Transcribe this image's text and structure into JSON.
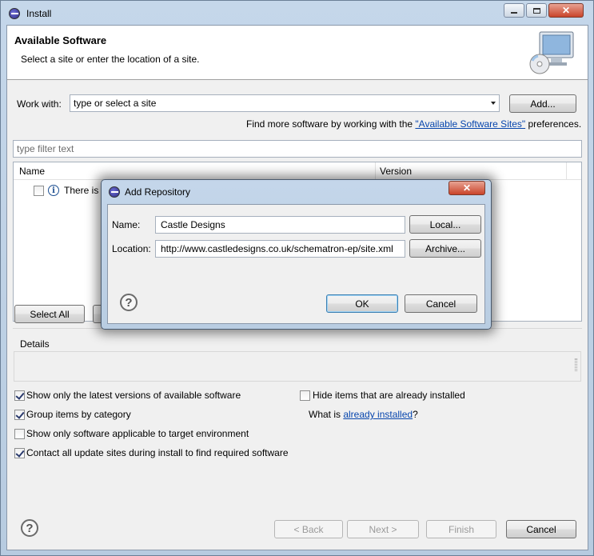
{
  "window": {
    "title": "Install",
    "banner_title": "Available Software",
    "banner_desc": "Select a site or enter the location of a site."
  },
  "work_with": {
    "label": "Work with:",
    "value": "type or select a site",
    "add_button": "Add...",
    "find_more_prefix": "Find more software by working with the ",
    "find_more_link": "\"Available Software Sites\"",
    "find_more_suffix": " preferences."
  },
  "filter": {
    "placeholder": "type filter text"
  },
  "tree": {
    "columns": [
      "Name",
      "Version"
    ],
    "row_text": "There is n"
  },
  "buttons": {
    "select_all": "Select All"
  },
  "details": {
    "label": "Details"
  },
  "options": [
    {
      "label": "Show only the latest versions of available software",
      "checked": true
    },
    {
      "label": "Group items by category",
      "checked": true
    },
    {
      "label": "Show only software applicable to target environment",
      "checked": false
    },
    {
      "label": "Contact all update sites during install to find required software",
      "checked": true
    },
    {
      "label": "Hide items that are already installed",
      "checked": false
    }
  ],
  "what_is": {
    "prefix": "What is ",
    "link": "already installed",
    "suffix": "?"
  },
  "footer": {
    "back": "< Back",
    "next": "Next >",
    "finish": "Finish",
    "cancel": "Cancel"
  },
  "dialog": {
    "title": "Add Repository",
    "name_label": "Name:",
    "name_value": "Castle Designs",
    "location_label": "Location:",
    "location_value": "http://www.castledesigns.co.uk/schematron-ep/site.xml",
    "local_button": "Local...",
    "archive_button": "Archive...",
    "ok_button": "OK",
    "cancel_button": "Cancel"
  },
  "icons": {
    "app": "eclipse-icon",
    "banner": "computer-cd-icon",
    "help": "help-icon",
    "info": "info-icon"
  }
}
